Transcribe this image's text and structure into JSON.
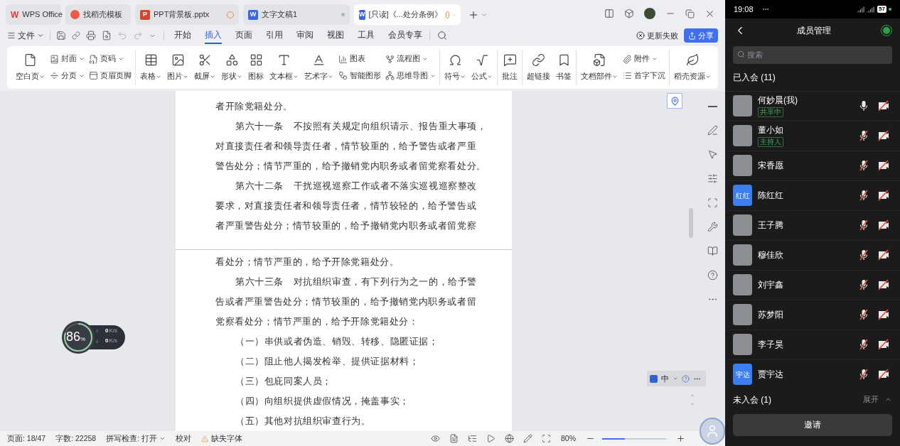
{
  "tabs": [
    {
      "label": "WPS Office",
      "badge": "W",
      "kind": "home",
      "selected": false
    },
    {
      "label": "找稻壳模板",
      "kind": "template",
      "selected": false
    },
    {
      "label": "PPT背景板.pptx",
      "badge": "P",
      "kind": "slides",
      "warning": true,
      "selected": false
    },
    {
      "label": "文字文稿1",
      "badge": "W",
      "kind": "doc",
      "unsaved": true,
      "selected": false
    },
    {
      "label": "[只读]《...处分条例》",
      "badge": "W",
      "kind": "doc",
      "warning": true,
      "selected": true
    }
  ],
  "menu": {
    "file": "文件",
    "tabs": [
      {
        "label": "开始",
        "selected": false
      },
      {
        "label": "插入",
        "selected": true
      },
      {
        "label": "页面",
        "selected": false
      },
      {
        "label": "引用",
        "selected": false
      },
      {
        "label": "审阅",
        "selected": false
      },
      {
        "label": "视图",
        "selected": false
      },
      {
        "label": "工具",
        "selected": false
      },
      {
        "label": "会员专享",
        "selected": false
      }
    ],
    "update_status": "更新失败",
    "share": "分享"
  },
  "ribbon": {
    "groups": [
      {
        "items": [
          {
            "kind": "large",
            "label": "空白页",
            "dropdown": true
          },
          {
            "kind": "stack",
            "items": [
              {
                "label": "封面",
                "dropdown": true
              },
              {
                "label": "分页",
                "dropdown": true
              }
            ]
          },
          {
            "kind": "stack",
            "items": [
              {
                "label": "页码",
                "dropdown": true
              },
              {
                "label": "页眉页脚",
                "dropdown": false
              }
            ]
          }
        ]
      },
      {
        "items": [
          {
            "kind": "large",
            "label": "表格",
            "dropdown": true
          },
          {
            "kind": "large",
            "label": "图片",
            "dropdown": true
          },
          {
            "kind": "large",
            "label": "截屏",
            "dropdown": true
          },
          {
            "kind": "large",
            "label": "形状",
            "dropdown": true
          },
          {
            "kind": "large",
            "label": "图标",
            "dropdown": false
          },
          {
            "kind": "large",
            "label": "文本框",
            "dropdown": true
          },
          {
            "kind": "large",
            "label": "艺术字",
            "dropdown": true
          },
          {
            "kind": "stack",
            "items": [
              {
                "label": "图表",
                "dropdown": false
              },
              {
                "label": "智能图形",
                "dropdown": false
              }
            ]
          },
          {
            "kind": "stack",
            "items": [
              {
                "label": "流程图",
                "dropdown": true
              },
              {
                "label": "思维导图",
                "dropdown": true
              }
            ]
          }
        ]
      },
      {
        "items": [
          {
            "kind": "large",
            "label": "符号",
            "dropdown": true
          },
          {
            "kind": "large",
            "label": "公式",
            "dropdown": true
          }
        ]
      },
      {
        "items": [
          {
            "kind": "large",
            "label": "批注",
            "dropdown": false
          }
        ]
      },
      {
        "items": [
          {
            "kind": "large",
            "label": "超链接",
            "dropdown": false
          },
          {
            "kind": "large",
            "label": "书签",
            "dropdown": false
          }
        ]
      },
      {
        "items": [
          {
            "kind": "large",
            "label": "文档部件",
            "dropdown": true
          },
          {
            "kind": "stack",
            "items": [
              {
                "label": "附件",
                "dropdown": true
              },
              {
                "label": "首字下沉",
                "dropdown": false
              }
            ]
          }
        ]
      },
      {
        "items": [
          {
            "kind": "large",
            "label": "稻壳资源",
            "dropdown": true
          }
        ]
      }
    ]
  },
  "document": {
    "pages": [
      {
        "lines": [
          {
            "text": "者开除党籍处分。",
            "indent": false
          },
          {
            "text": "第六十一条　不按照有关规定向组织请示、报告重大事项，",
            "indent": true
          },
          {
            "text": "对直接责任者和领导责任者，情节较重的，给予警告或者严重",
            "indent": false
          },
          {
            "text": "警告处分；情节严重的，给予撤销党内职务或者留党察看处分。",
            "indent": false
          },
          {
            "text": "第六十二条　干扰巡视巡察工作或者不落实巡视巡察整改",
            "indent": true
          },
          {
            "text": "要求，对直接责任者和领导责任者，情节较轻的，给予警告或",
            "indent": false
          },
          {
            "text": "者严重警告处分；情节较重的，给予撤销党内职务或者留党察",
            "indent": false
          }
        ]
      },
      {
        "lines": [
          {
            "text": "看处分；情节严重的，给予开除党籍处分。",
            "indent": false
          },
          {
            "text": "第六十三条　对抗组织审查，有下列行为之一的，给予警",
            "indent": true
          },
          {
            "text": "告或者严重警告处分；情节较重的，给予撤销党内职务或者留",
            "indent": false
          },
          {
            "text": "党察看处分；情节严重的，给予开除党籍处分：",
            "indent": false
          },
          {
            "text": "（一）串供或者伪造、销毁、转移、隐匿证据；",
            "indent": true
          },
          {
            "text": "（二）阻止他人揭发检举、提供证据材料；",
            "indent": true
          },
          {
            "text": "（三）包庇同案人员；",
            "indent": true
          },
          {
            "text": "（四）向组织提供虚假情况，掩盖事实；",
            "indent": true
          },
          {
            "text": "（五）其他对抗组织审查行为。",
            "indent": true
          }
        ]
      }
    ]
  },
  "status_bar": {
    "page": "页面: 18/47",
    "words": "字数: 22258",
    "spell": "拼写检查: 打开",
    "proofread": "校对",
    "missing_font": "缺失字体",
    "zoom": "80%",
    "zoom_slider": {
      "level": 0.35
    }
  },
  "speed_widget": {
    "percent": "86",
    "unit": "%",
    "upload": {
      "value": "0",
      "unit": "K/s"
    },
    "download": {
      "value": "0",
      "unit": "K/s"
    }
  },
  "ime_bar": {
    "mode": "中"
  },
  "phone": {
    "status_bar": {
      "time": "19:08",
      "battery": "57"
    },
    "title": "成员管理",
    "search": {
      "placeholder": "搜索"
    },
    "joined_title": "已入会 (11)",
    "members": [
      {
        "name": "何妙晨(我)",
        "avatar": {
          "kind": "photo"
        },
        "tag": {
          "text": "共享中"
        },
        "mic_on": true,
        "camera_on": false
      },
      {
        "name": "董小如",
        "avatar": {
          "kind": "photo"
        },
        "tag": {
          "text": "主持人"
        },
        "mic_on": false,
        "camera_on": false
      },
      {
        "name": "宋香愿",
        "avatar": {
          "kind": "photo"
        },
        "mic_on": false,
        "camera_on": false
      },
      {
        "name": "陈红红",
        "avatar": {
          "kind": "text",
          "text": "红红"
        },
        "mic_on": false,
        "camera_on": false
      },
      {
        "name": "王子腾",
        "avatar": {
          "kind": "photo"
        },
        "mic_on": false,
        "camera_on": false
      },
      {
        "name": "穆佳欣",
        "avatar": {
          "kind": "photo"
        },
        "mic_on": false,
        "camera_on": false
      },
      {
        "name": "刘宇鑫",
        "avatar": {
          "kind": "photo"
        },
        "mic_on": false,
        "camera_on": false
      },
      {
        "name": "苏梦阳",
        "avatar": {
          "kind": "photo"
        },
        "mic_on": false,
        "camera_on": false
      },
      {
        "name": "李子昊",
        "avatar": {
          "kind": "photo"
        },
        "mic_on": false,
        "camera_on": false
      },
      {
        "name": "贾宇达",
        "avatar": {
          "kind": "text",
          "text": "宇达"
        },
        "mic_on": false,
        "camera_on": false
      }
    ],
    "not_joined": {
      "title": "未入会 (1)",
      "action": "展开",
      "expanded": false
    },
    "invite": "邀请"
  }
}
